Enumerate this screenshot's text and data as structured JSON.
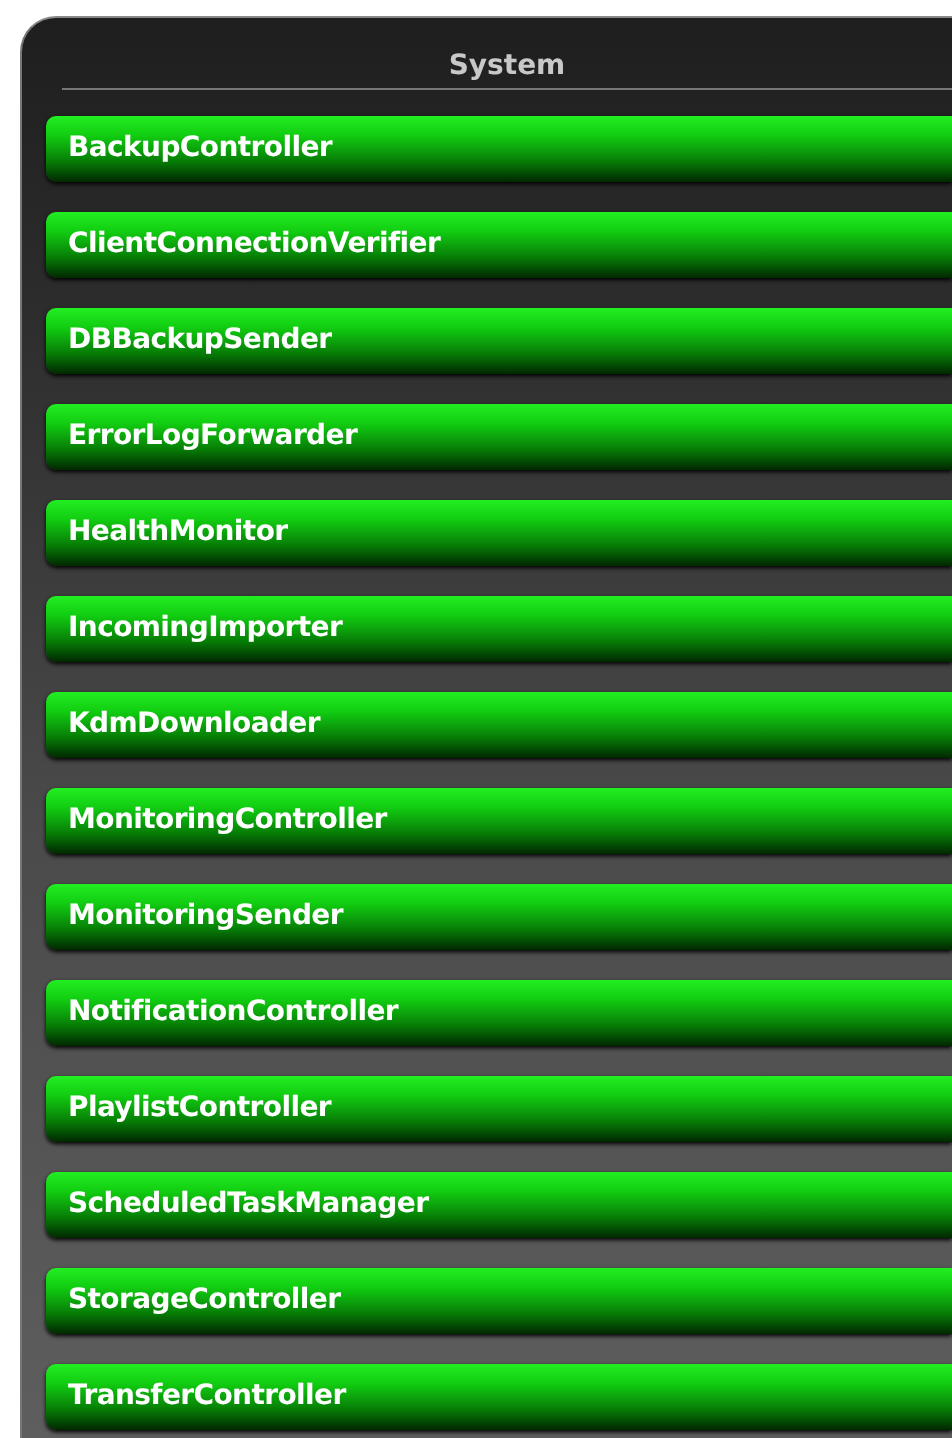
{
  "panel": {
    "title": "System"
  },
  "items": [
    {
      "label": "BackupController"
    },
    {
      "label": "ClientConnectionVerifier"
    },
    {
      "label": "DBBackupSender"
    },
    {
      "label": "ErrorLogForwarder"
    },
    {
      "label": "HealthMonitor"
    },
    {
      "label": "IncomingImporter"
    },
    {
      "label": "KdmDownloader"
    },
    {
      "label": "MonitoringController"
    },
    {
      "label": "MonitoringSender"
    },
    {
      "label": "NotificationController"
    },
    {
      "label": "PlaylistController"
    },
    {
      "label": "ScheduledTaskManager"
    },
    {
      "label": "StorageController"
    },
    {
      "label": "TransferController"
    }
  ]
}
